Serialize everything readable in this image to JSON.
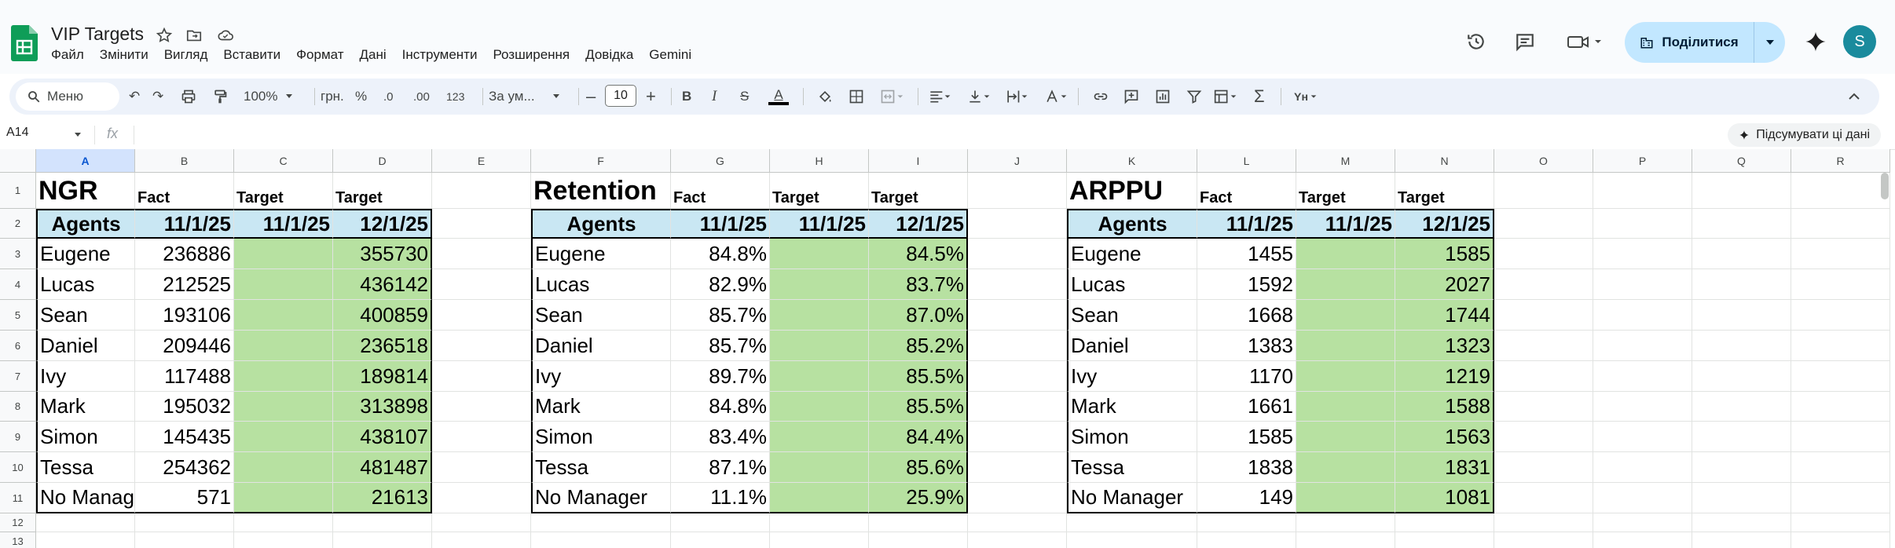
{
  "app": {
    "title": "VIP Targets",
    "menu": [
      "Файл",
      "Змінити",
      "Вигляд",
      "Вставити",
      "Формат",
      "Дані",
      "Інструменти",
      "Розширення",
      "Довідка",
      "Gemini"
    ],
    "share_label": "Поділитися",
    "avatar_letter": "S",
    "brand_color": "#0f9d58",
    "share_color": "#c2e7ff"
  },
  "toolbar": {
    "search_label": "Меню",
    "zoom": "100%",
    "currency": "грн.",
    "percent": "%",
    "dec_less": ".0",
    "dec_more": ".00",
    "number_format": "123",
    "font": "За ум...",
    "font_size": "10",
    "bold": "B",
    "italic": "I",
    "strike": "S",
    "text_color": "A"
  },
  "formula": {
    "cell_ref": "A14",
    "fx": "fx",
    "summarize_label": "Підсумувати ці дані"
  },
  "grid": {
    "columns": [
      "A",
      "B",
      "C",
      "D",
      "E",
      "F",
      "G",
      "H",
      "I",
      "J",
      "K",
      "L",
      "M",
      "N",
      "O",
      "P",
      "Q",
      "R"
    ],
    "rows": [
      "1",
      "2",
      "3",
      "4",
      "5",
      "6",
      "7",
      "8",
      "9",
      "10",
      "11",
      "12",
      "13"
    ],
    "selected_column": "A"
  },
  "tables": [
    {
      "title": "NGR",
      "sub": [
        "Fact",
        "Target",
        "Target"
      ],
      "headers": [
        "Agents",
        "11/1/25",
        "11/1/25",
        "12/1/25"
      ],
      "rows": [
        [
          "Eugene",
          "236886",
          "",
          "355730"
        ],
        [
          "Lucas",
          "212525",
          "",
          "436142"
        ],
        [
          "Sean",
          "193106",
          "",
          "400859"
        ],
        [
          "Daniel",
          "209446",
          "",
          "236518"
        ],
        [
          "Ivy",
          "117488",
          "",
          "189814"
        ],
        [
          "Mark",
          "195032",
          "",
          "313898"
        ],
        [
          "Simon",
          "145435",
          "",
          "438107"
        ],
        [
          "Tessa",
          "254362",
          "",
          "481487"
        ],
        [
          "No Manag",
          "571",
          "",
          "21613"
        ]
      ]
    },
    {
      "title": "Retention",
      "sub": [
        "Fact",
        "Target",
        "Target"
      ],
      "headers": [
        "Agents",
        "11/1/25",
        "11/1/25",
        "12/1/25"
      ],
      "rows": [
        [
          "Eugene",
          "84.8%",
          "",
          "84.5%"
        ],
        [
          "Lucas",
          "82.9%",
          "",
          "83.7%"
        ],
        [
          "Sean",
          "85.7%",
          "",
          "87.0%"
        ],
        [
          "Daniel",
          "85.7%",
          "",
          "85.2%"
        ],
        [
          "Ivy",
          "89.7%",
          "",
          "85.5%"
        ],
        [
          "Mark",
          "84.8%",
          "",
          "85.5%"
        ],
        [
          "Simon",
          "83.4%",
          "",
          "84.4%"
        ],
        [
          "Tessa",
          "87.1%",
          "",
          "85.6%"
        ],
        [
          "No Manager",
          "11.1%",
          "",
          "25.9%"
        ]
      ]
    },
    {
      "title": "ARPPU",
      "sub": [
        "Fact",
        "Target",
        "Target"
      ],
      "headers": [
        "Agents",
        "11/1/25",
        "11/1/25",
        "12/1/25"
      ],
      "rows": [
        [
          "Eugene",
          "1455",
          "",
          "1585"
        ],
        [
          "Lucas",
          "1592",
          "",
          "2027"
        ],
        [
          "Sean",
          "1668",
          "",
          "1744"
        ],
        [
          "Daniel",
          "1383",
          "",
          "1323"
        ],
        [
          "Ivy",
          "1170",
          "",
          "1219"
        ],
        [
          "Mark",
          "1661",
          "",
          "1588"
        ],
        [
          "Simon",
          "1585",
          "",
          "1563"
        ],
        [
          "Tessa",
          "1838",
          "",
          "1831"
        ],
        [
          "No Manager",
          "149",
          "",
          "1081"
        ]
      ]
    }
  ]
}
